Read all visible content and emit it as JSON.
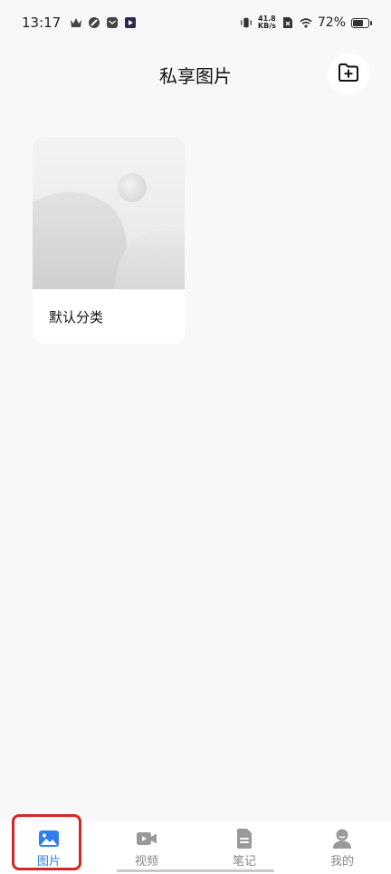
{
  "status_bar": {
    "time": "13:17",
    "net_speed_value": "41.8",
    "net_speed_unit": "KB/s",
    "battery_percent": "72%",
    "battery_level": 0.72
  },
  "header": {
    "title": "私享图片",
    "add_icon": "folder-plus-icon"
  },
  "albums": [
    {
      "name": "默认分类",
      "thumbnail_icon": "image-placeholder-icon"
    }
  ],
  "bottom_nav": {
    "items": [
      {
        "label": "图片",
        "icon": "image-icon",
        "active": true
      },
      {
        "label": "视频",
        "icon": "video-icon",
        "active": false
      },
      {
        "label": "笔记",
        "icon": "note-icon",
        "active": false
      },
      {
        "label": "我的",
        "icon": "profile-icon",
        "active": false
      }
    ]
  },
  "colors": {
    "accent": "#2f7ff0",
    "inactive": "#888888",
    "highlight": "#d32828",
    "background": "#f8f8f8"
  }
}
